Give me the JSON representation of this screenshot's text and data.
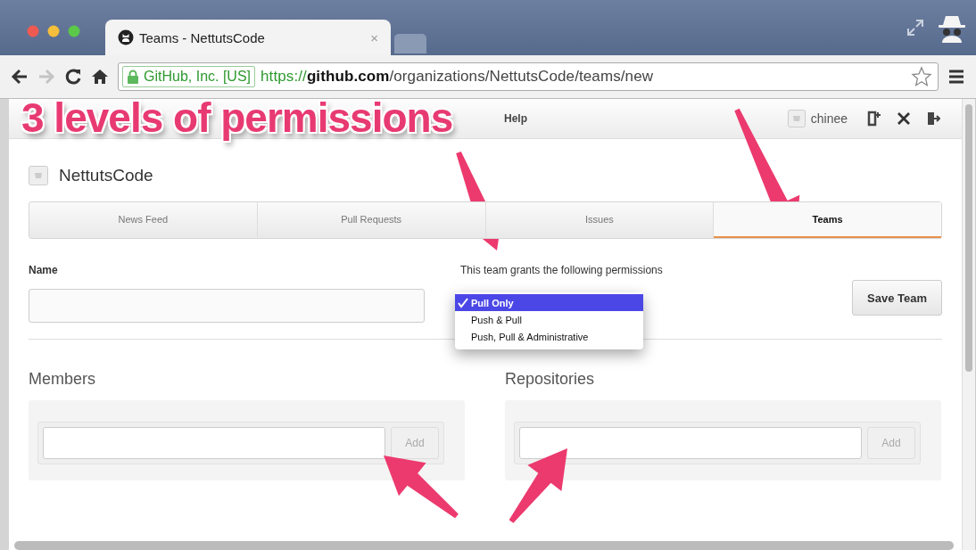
{
  "browser": {
    "tab": {
      "title": "Teams - NettutsCode",
      "close": "×"
    },
    "toolbar": {
      "identity": "GitHub, Inc. [US]",
      "url_scheme": "https://",
      "url_host": "github.com",
      "url_path": "/organizations/NettutsCode/teams/new"
    }
  },
  "annotation": {
    "text": "3 levels of permissions"
  },
  "header": {
    "links": [
      "Help"
    ],
    "user": "chinee"
  },
  "organization": {
    "name": "NettutsCode"
  },
  "tabs": [
    {
      "label": "News Feed",
      "selected": false
    },
    {
      "label": "Pull Requests",
      "selected": false
    },
    {
      "label": "Issues",
      "selected": false
    },
    {
      "label": "Teams",
      "selected": true
    }
  ],
  "form": {
    "name_label": "Name",
    "permissions_label": "This team grants the following permissions",
    "permission_options": [
      {
        "label": "Pull Only",
        "selected": true
      },
      {
        "label": "Push & Pull",
        "selected": false
      },
      {
        "label": "Push, Pull & Administrative",
        "selected": false
      }
    ],
    "save_button": "Save Team"
  },
  "sections": [
    {
      "title": "Members",
      "button": "Add"
    },
    {
      "title": "Repositories",
      "button": "Add"
    }
  ]
}
